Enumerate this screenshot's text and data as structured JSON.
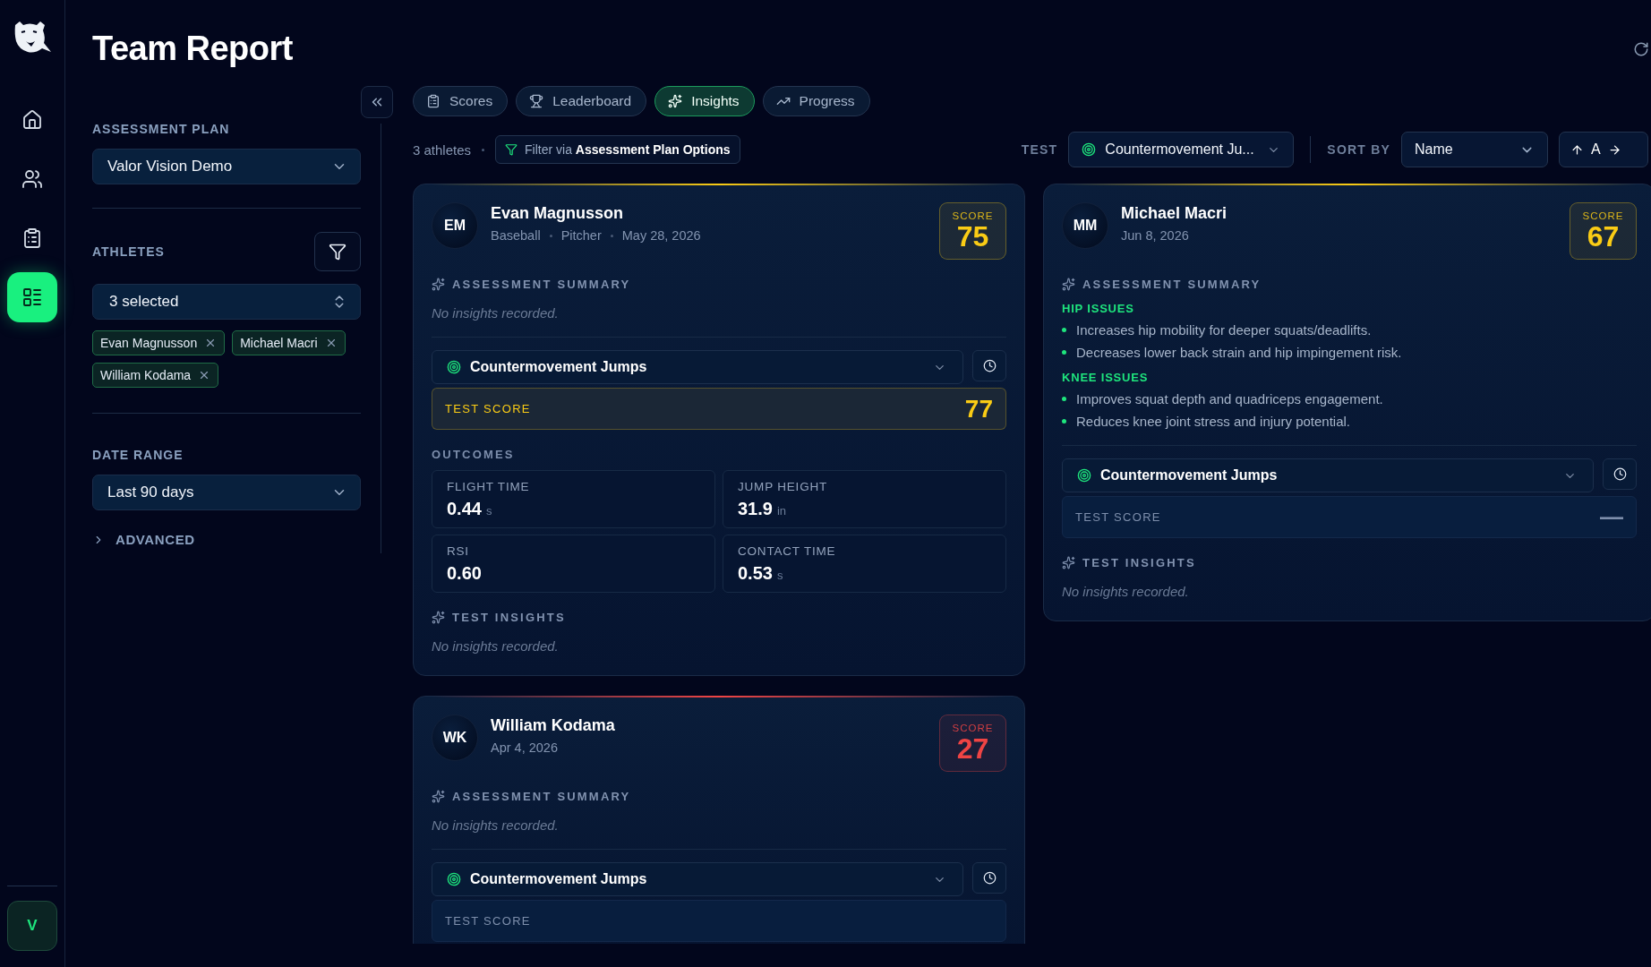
{
  "nav": {
    "items": [
      {
        "selected": false
      },
      {
        "selected": false
      },
      {
        "selected": false
      },
      {
        "selected": true
      }
    ],
    "user_initial": "V"
  },
  "title": "Team Report",
  "filters": {
    "assessment_plan": {
      "label": "ASSESSMENT PLAN",
      "value": "Valor Vision Demo"
    },
    "athletes": {
      "label": "ATHLETES",
      "value": "3 selected",
      "chips": [
        "Evan Magnusson",
        "Michael Macri",
        "William Kodama"
      ]
    },
    "date_range": {
      "label": "DATE RANGE",
      "value": "Last 90 days"
    },
    "advanced": {
      "label": "ADVANCED",
      "expanded": false
    }
  },
  "tabs": [
    {
      "label": "Scores",
      "selected": false
    },
    {
      "label": "Leaderboard",
      "selected": false
    },
    {
      "label": "Insights",
      "selected": true
    },
    {
      "label": "Progress",
      "selected": false
    }
  ],
  "toolbar": {
    "count": "3 athletes",
    "filter_link": "Filter via **Assessment Plan Options**",
    "test_label": "TEST",
    "test_value": "Countermovement Ju...",
    "sort_label": "SORT BY",
    "sort_value": "Name",
    "sort_direction": "A"
  },
  "athletes": [
    {
      "initials": "EM",
      "name": "Evan Magnusson",
      "meta": [
        "Baseball",
        "Pitcher",
        "May 28, 2026"
      ],
      "color": "#facc15",
      "score_label": "SCORE",
      "score": "75",
      "summary": {
        "title": "ASSESSMENT SUMMARY",
        "empty": "No insights recorded."
      },
      "test": "Countermovement Jumps",
      "test_score": {
        "label": "TEST SCORE",
        "value": "77",
        "color": "#facc15"
      },
      "outcomes": {
        "title": "OUTCOMES",
        "metrics": [
          {
            "label": "FLIGHT TIME",
            "value": "0.44",
            "unit": "s"
          },
          {
            "label": "JUMP HEIGHT",
            "value": "31.9",
            "unit": "in"
          },
          {
            "label": "RSI",
            "value": "0.60"
          },
          {
            "label": "CONTACT TIME",
            "value": "0.53",
            "unit": "s"
          }
        ]
      },
      "insights": {
        "title": "TEST INSIGHTS",
        "empty": "No insights recorded."
      }
    },
    {
      "initials": "MM",
      "name": "Michael Macri",
      "meta": [
        "Jun 8, 2026"
      ],
      "color": "#facc15",
      "score_label": "SCORE",
      "score": "67",
      "summary": {
        "title": "ASSESSMENT SUMMARY",
        "groups": [
          {
            "title": "HIP ISSUES",
            "items": [
              "Increases hip mobility for deeper squats/deadlifts.",
              "Decreases lower back strain and hip impingement risk."
            ]
          },
          {
            "title": "KNEE ISSUES",
            "items": [
              "Improves squat depth and quadriceps engagement.",
              "Reduces knee joint stress and injury potential."
            ]
          }
        ]
      },
      "test": "Countermovement Jumps",
      "test_score": {
        "label": "TEST SCORE",
        "value": "—"
      },
      "insights": {
        "title": "TEST INSIGHTS",
        "empty": "No insights recorded."
      }
    },
    {
      "initials": "WK",
      "name": "William Kodama",
      "meta": [
        "Apr 4, 2026"
      ],
      "color": "#ef4444",
      "score_label": "SCORE",
      "score": "27",
      "summary": {
        "title": "ASSESSMENT SUMMARY",
        "empty": "No insights recorded."
      },
      "test": "Countermovement Jumps",
      "test_score": {
        "label": "TEST SCORE"
      }
    }
  ]
}
